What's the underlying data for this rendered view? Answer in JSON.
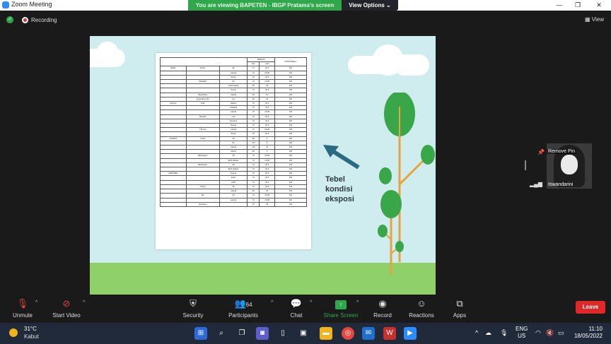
{
  "window": {
    "title": "Zoom Meeting",
    "viewing_banner": "You are viewing BAPETEN - IBGP Pratama's screen",
    "view_options": "View Options",
    "recording": "Recording",
    "view_menu": "View"
  },
  "slide": {
    "caption_lines": [
      "Tebel",
      "kondisi",
      "eksposi"
    ],
    "table": {
      "header_medium": "MEDIUM",
      "header_distance": "DISTANCE(m)",
      "header_kvp": "kVp",
      "header_mas": "mAs",
      "rows": [
        [
          "HEAD",
          "SKULL",
          "AP",
          "72",
          "20.6",
          "100"
        ],
        [
          "",
          "",
          "Lateral",
          "72",
          "20.48",
          "100"
        ],
        [
          "",
          "",
          "Towns",
          "76",
          "20.6",
          "100"
        ],
        [
          "",
          "Mandible",
          "PA",
          "70",
          "20.48",
          "100"
        ],
        [
          "",
          "",
          "Axial Lateral",
          "66",
          "20",
          "100"
        ],
        [
          "",
          "",
          "Towns",
          "74",
          "20.6",
          "100"
        ],
        [
          "",
          "Nasal Bone",
          "Lateral",
          "50",
          "6.4",
          "100"
        ],
        [
          "",
          "Zygomatic arch",
          "smv",
          "66",
          "10",
          "100"
        ],
        [
          "FACIAL",
          "PNS",
          "Waters",
          "70",
          "20.6",
          "100"
        ],
        [
          "",
          "",
          "Caldwell",
          "72",
          "20.6",
          "100"
        ],
        [
          "",
          "",
          "Lateral",
          "72",
          "20.48",
          "100"
        ],
        [
          "",
          "Mastoid",
          "Law",
          "70",
          "20.6",
          "100"
        ],
        [
          "",
          "",
          "Stenvers",
          "70",
          "20.6",
          "100"
        ],
        [
          "",
          "",
          "Townes",
          "76",
          "20.6",
          "100"
        ],
        [
          "",
          "T.M joint",
          "Lateral",
          "72",
          "20.48",
          "100"
        ],
        [
          "",
          "",
          "Towns",
          "76",
          "20.6",
          "100"
        ],
        [
          "THORAX",
          "Chest",
          "AP",
          "80",
          "4",
          "100"
        ],
        [
          "",
          "",
          "PA",
          "110",
          "3",
          "100"
        ],
        [
          "",
          "",
          "Lateral",
          "110",
          "10",
          "100"
        ],
        [
          "",
          "",
          "AP/CD",
          "80",
          "4",
          "100"
        ],
        [
          "",
          "Ribs(upper)",
          "AP",
          "76",
          "20.48",
          "100"
        ],
        [
          "",
          "",
          "Both oblique",
          "72",
          "20.48",
          "100"
        ],
        [
          "",
          "Ribs(lower)",
          "AP",
          "74",
          "20.6",
          "100"
        ],
        [
          "",
          "",
          "Both oblique",
          "76",
          "20.6",
          "100"
        ],
        [
          "ABDOMEN",
          "",
          "Supine",
          "76",
          "20.6",
          "100"
        ],
        [
          "",
          "",
          "Erect",
          "76",
          "20.6",
          "100"
        ],
        [
          "",
          "",
          "KUB",
          "76",
          "20.6",
          "100"
        ],
        [
          "",
          "Pelvis",
          "AP",
          "76",
          "20.6",
          "100"
        ],
        [
          "",
          "",
          "Lateral",
          "80",
          "40",
          "100"
        ],
        [
          "",
          "Hip",
          "AP",
          "70",
          "20.48",
          "100"
        ],
        [
          "",
          "",
          "Lateral",
          "70",
          "20.48",
          "100"
        ],
        [
          "",
          "decubitus",
          "",
          "76",
          "32",
          "100"
        ]
      ]
    }
  },
  "participant": {
    "name": "Iswandarini",
    "pinned": "Remove Pin"
  },
  "toolbar": {
    "unmute": "Unmute",
    "start_video": "Start Video",
    "security": "Security",
    "participants": "Participants",
    "participants_count": "64",
    "chat": "Chat",
    "share_screen": "Share Screen",
    "record": "Record",
    "reactions": "Reactions",
    "apps": "Apps",
    "leave": "Leave"
  },
  "taskbar": {
    "temperature": "31°C",
    "condition": "Kabut",
    "lang_top": "ENG",
    "lang_bottom": "US",
    "time": "11:10",
    "date": "18/05/2022"
  },
  "colors": {
    "share_green": "#2ea84a",
    "leave_red": "#e02828",
    "slide_bg": "#cfecef",
    "grass": "#8fd06a"
  }
}
